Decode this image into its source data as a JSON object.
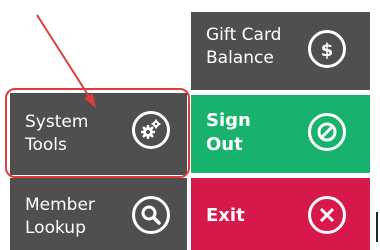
{
  "tiles": {
    "gift_card": {
      "label": "Gift Card\nBalance",
      "icon": "dollar-icon"
    },
    "system_tools": {
      "label": "System\nTools",
      "icon": "gears-icon"
    },
    "sign_out": {
      "label": "Sign\nOut",
      "icon": "cancel-circle-icon"
    },
    "member_lookup": {
      "label": "Member\nLookup",
      "icon": "search-icon"
    },
    "exit": {
      "label": "Exit",
      "icon": "close-icon"
    }
  },
  "annotation": {
    "highlight_color": "#e23b3b",
    "target": "system-tools"
  },
  "colors": {
    "dark_tile": "#4f4f4f",
    "green": "#17b26b",
    "red": "#d7194a"
  }
}
